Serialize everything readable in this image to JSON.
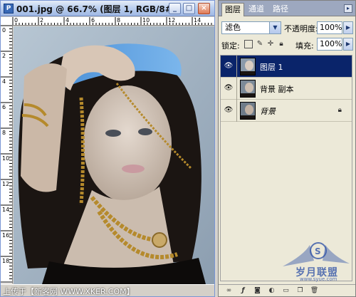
{
  "document": {
    "icon_letter": "P",
    "title": "001.jpg @ 66.7% (图层 1, RGB/8#)",
    "ruler_h_labels": [
      "0",
      "2",
      "4",
      "6",
      "8",
      "10",
      "12",
      "14"
    ],
    "ruler_v_labels": [
      "0",
      "2",
      "4",
      "6",
      "8",
      "10",
      "12",
      "14",
      "16",
      "18"
    ],
    "status_text": "上传于【新客网 WWW.XKER.COM】"
  },
  "window_buttons": {
    "minimize": "_",
    "maximize": "□",
    "close": "×"
  },
  "palette": {
    "tabs": [
      "图层",
      "通道",
      "路径"
    ],
    "active_tab": "图层",
    "menu_icon": "▸",
    "blend_mode": "滤色",
    "opacity_label": "不透明度:",
    "opacity_value": "100%",
    "lock_label": "锁定:",
    "fill_label": "填充:",
    "fill_value": "100%",
    "layers": [
      {
        "name": "图层 1",
        "selected": true,
        "italic": false,
        "locked": false
      },
      {
        "name": "背景 副本",
        "selected": false,
        "italic": false,
        "locked": false
      },
      {
        "name": "背景",
        "selected": false,
        "italic": true,
        "locked": true
      }
    ],
    "icons": {
      "eye": "eye-icon",
      "lock": "lock-icon",
      "link": "link-icon",
      "fx": "fx-icon",
      "mask": "mask-icon",
      "adjust": "adjustment-icon",
      "folder": "folder-icon",
      "new_layer": "new-layer-icon",
      "trash": "trash-icon"
    }
  },
  "watermark": {
    "text": "岁月联盟",
    "url": "www.syue.com"
  },
  "colors": {
    "selected_layer": "#0a246a",
    "titlebar": "#bcd0ef",
    "palette_bg": "#ece9d8"
  }
}
